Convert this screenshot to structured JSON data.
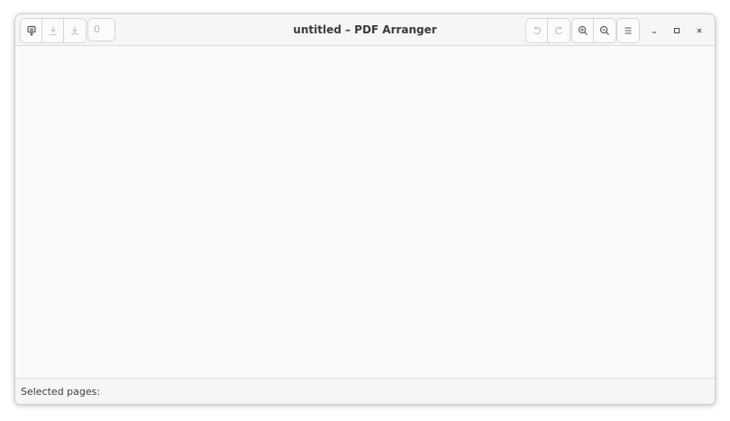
{
  "window": {
    "title": "untitled – PDF Arranger"
  },
  "toolbar": {
    "left_buttons": [
      {
        "icon": "document-open-icon",
        "enabled": true
      },
      {
        "icon": "save-icon",
        "enabled": false
      },
      {
        "icon": "save-as-icon",
        "enabled": false
      }
    ],
    "page_entry_value": "0",
    "right_buttons": [
      {
        "icon": "undo-icon",
        "enabled": false
      },
      {
        "icon": "redo-icon",
        "enabled": false
      },
      {
        "icon": "zoom-in-icon",
        "enabled": true
      },
      {
        "icon": "zoom-out-icon",
        "enabled": true
      },
      {
        "icon": "hamburger-menu-icon",
        "enabled": true
      }
    ]
  },
  "window_controls": [
    "minimize-icon",
    "maximize-icon",
    "close-icon"
  ],
  "statusbar": {
    "label": "Selected pages:",
    "value": ""
  },
  "colors": {
    "background": "#fafafa",
    "headerbar": "#f6f6f6",
    "border": "#d6d6d6",
    "icon_enabled": "#555555",
    "icon_disabled": "#c2c2c2"
  }
}
